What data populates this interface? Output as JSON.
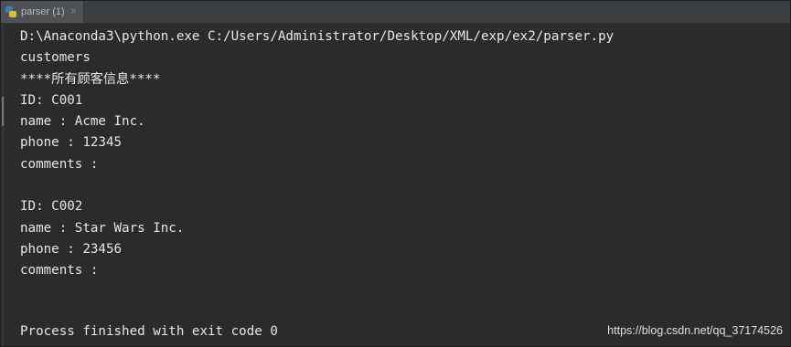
{
  "tab": {
    "title": "parser (1)",
    "close_symbol": "×",
    "icon": "python-icon"
  },
  "console": {
    "lines": [
      "D:\\Anaconda3\\python.exe C:/Users/Administrator/Desktop/XML/exp/ex2/parser.py",
      "customers",
      "****所有顾客信息****",
      "ID: C001",
      "name : Acme Inc.",
      "phone : 12345",
      "comments :",
      "",
      "ID: C002",
      "name : Star Wars Inc.",
      "phone : 23456",
      "comments :"
    ],
    "exit_message": "Process finished with exit code 0"
  },
  "watermark": "https://blog.csdn.net/qq_37174526",
  "colors": {
    "background": "#2b2b2b",
    "tabbar": "#3c3f41",
    "text": "#e6e6e6"
  }
}
